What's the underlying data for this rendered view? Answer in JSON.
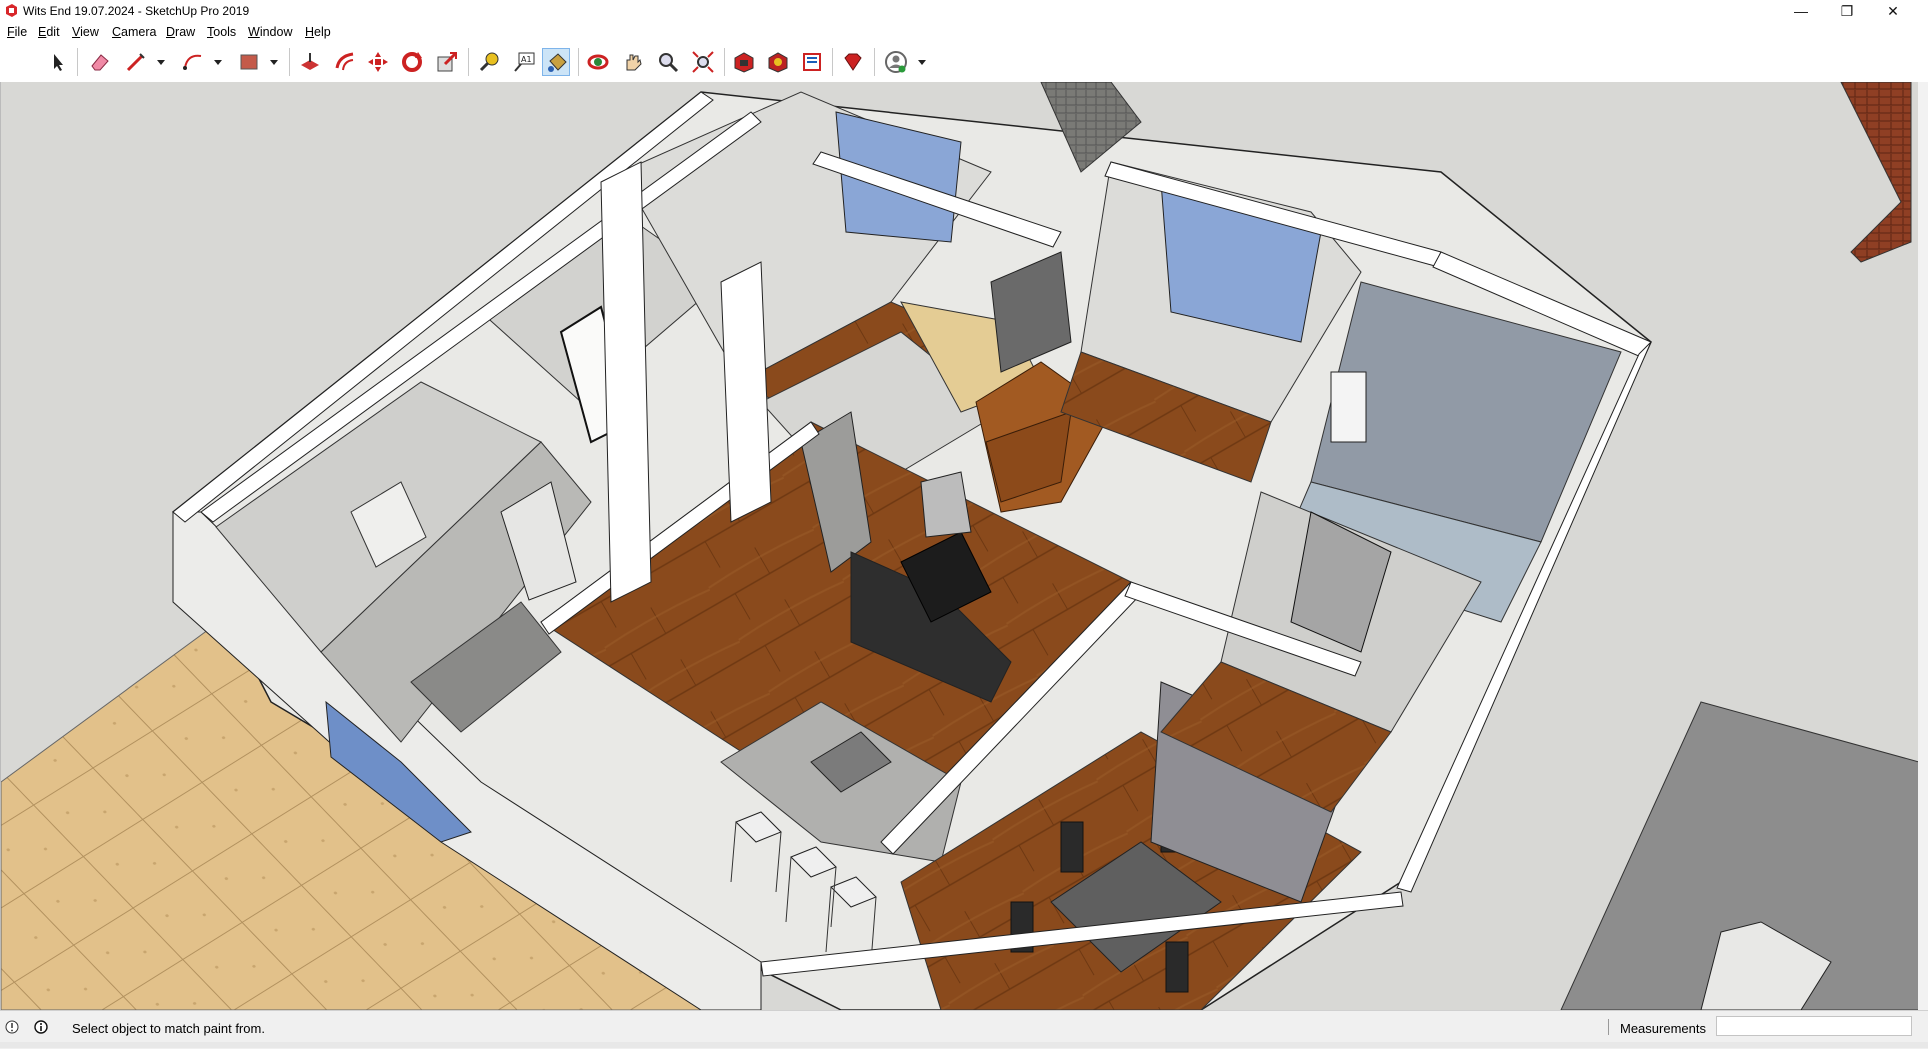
{
  "window": {
    "title": "Wits End 19.07.2024 - SketchUp Pro 2019",
    "minimize": "—",
    "maximize": "❐",
    "close": "✕"
  },
  "menu": [
    {
      "label": "File",
      "accent": "F"
    },
    {
      "label": "Edit",
      "accent": "E"
    },
    {
      "label": "View",
      "accent": "V"
    },
    {
      "label": "Camera",
      "accent": "C"
    },
    {
      "label": "Draw",
      "accent": "D"
    },
    {
      "label": "Tools",
      "accent": "T"
    },
    {
      "label": "Window",
      "accent": "W"
    },
    {
      "label": "Help",
      "accent": "H"
    }
  ],
  "toolbar": {
    "tools": [
      "select-icon",
      "eraser-icon",
      "line-icon",
      "arc-icon",
      "rectangle-icon",
      "push-pull-icon",
      "offset-icon",
      "move-icon",
      "rotate-icon",
      "scale-icon",
      "tape-measure-icon",
      "text-icon",
      "paint-bucket-icon",
      "orbit-icon",
      "pan-icon",
      "zoom-icon",
      "zoom-extents-icon",
      "3d-warehouse-icon",
      "extension-warehouse-icon",
      "layout-icon",
      "ruby-icon",
      "account-icon"
    ],
    "active_tool": "paint-bucket-icon"
  },
  "status": {
    "message": "Select object to match paint from.",
    "measurements_label": "Measurements",
    "measurements_value": ""
  },
  "colors": {
    "floor_wood": "#8a4a1c",
    "wall_white": "#f2f2f0",
    "wall_grey": "#d9d9d6",
    "patio_tile": "#e3c48e",
    "sky_bg": "#d8d8d5",
    "window_blue": "#8aa6d6",
    "active_tool_bg": "#cce4f7"
  }
}
